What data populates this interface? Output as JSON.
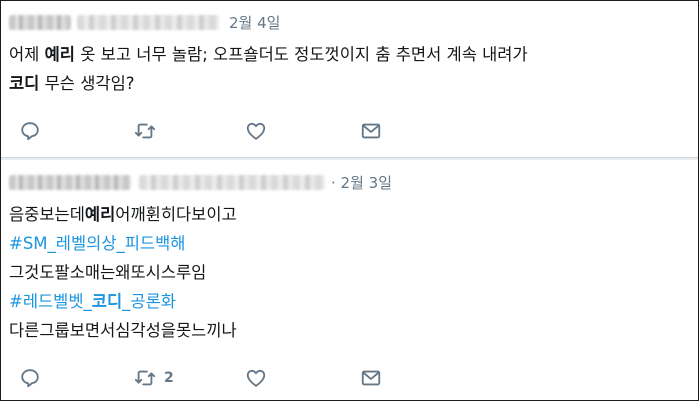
{
  "tweet1": {
    "date": "2월 4일",
    "line1": {
      "p1": "어제 ",
      "b1": "예리",
      "p2": " 옷 보고 너무 놀람; 오프숄더도 정도껏이지 춤 추면서 계속 내려가"
    },
    "line2": {
      "b1": "코디",
      "p1": " 무슨 생각임?"
    }
  },
  "tweet2": {
    "date": "· 2월 3일",
    "lines": {
      "l1": {
        "p1": "음중보는데",
        "b1": "예리",
        "p2": "어깨휜히다보이고"
      },
      "l2": "#SM_레벨의상_피드백해",
      "l3": "그것도팔소매는왜또시스루임",
      "l4": {
        "p1": "#레드벨벳_",
        "b1": "코디",
        "p2": "_공론화"
      },
      "l5": "다른그룹보면서심각성을못느끼나"
    },
    "retweet_count": "2"
  },
  "icons": [
    "reply-icon",
    "retweet-icon",
    "like-icon",
    "message-icon"
  ],
  "colors": {
    "text": "#14171a",
    "muted": "#657786",
    "hashtag": "#1b95e0",
    "icon": "#657786"
  }
}
